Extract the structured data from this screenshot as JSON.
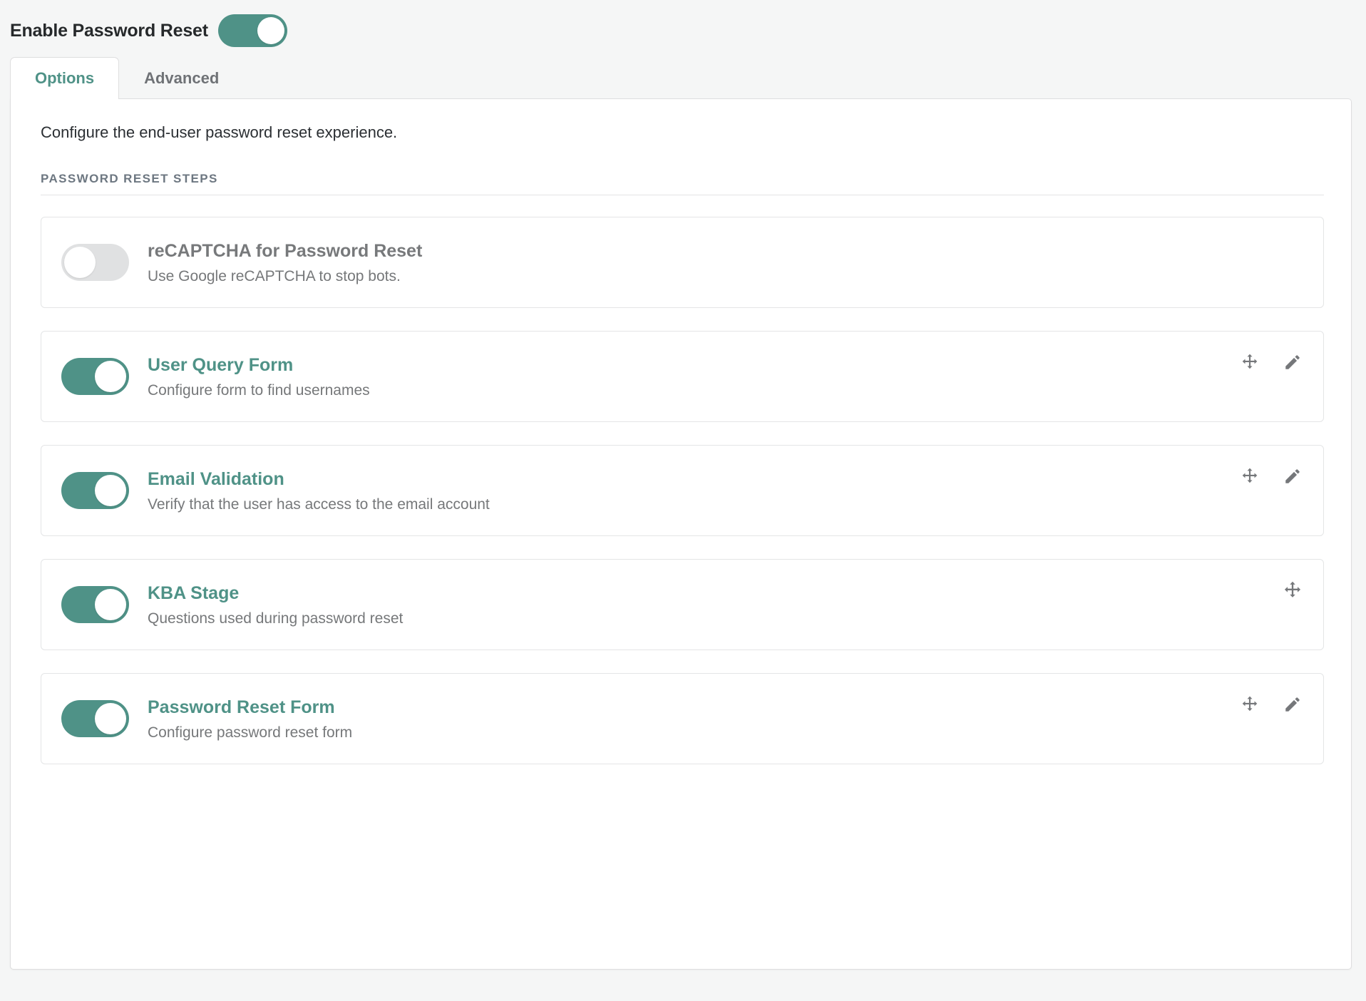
{
  "header": {
    "label": "Enable Password Reset",
    "toggle_state": "on",
    "toggle_name": "enable-password-reset-toggle"
  },
  "tabs": [
    {
      "label": "Options",
      "active": true
    },
    {
      "label": "Advanced",
      "active": false
    }
  ],
  "panel": {
    "description": "Configure the end-user password reset experience.",
    "section_title": "PASSWORD RESET STEPS"
  },
  "steps": [
    {
      "id": "recaptcha-for-password-reset",
      "title": "reCAPTCHA for Password Reset",
      "description": "Use Google reCAPTCHA to stop bots.",
      "enabled": false,
      "title_muted": true,
      "actions": []
    },
    {
      "id": "user-query-form",
      "title": "User Query Form",
      "description": "Configure form to find usernames",
      "enabled": true,
      "title_muted": false,
      "actions": [
        "move-icon",
        "edit-icon"
      ]
    },
    {
      "id": "email-validation",
      "title": "Email Validation",
      "description": "Verify that the user has access to the email account",
      "enabled": true,
      "title_muted": false,
      "actions": [
        "move-icon",
        "edit-icon"
      ]
    },
    {
      "id": "kba-stage",
      "title": "KBA Stage",
      "description": "Questions used during password reset",
      "enabled": true,
      "title_muted": false,
      "actions": [
        "move-icon"
      ]
    },
    {
      "id": "password-reset-form",
      "title": "Password Reset Form",
      "description": "Configure password reset form",
      "enabled": true,
      "title_muted": false,
      "actions": [
        "move-icon",
        "edit-icon"
      ]
    }
  ],
  "colors": {
    "accent": "#4f9287",
    "toggle_off": "#e0e1e2",
    "page_background": "#f5f6f6",
    "panel_background": "#ffffff",
    "border": "#dededf",
    "muted_text": "#76787a"
  }
}
